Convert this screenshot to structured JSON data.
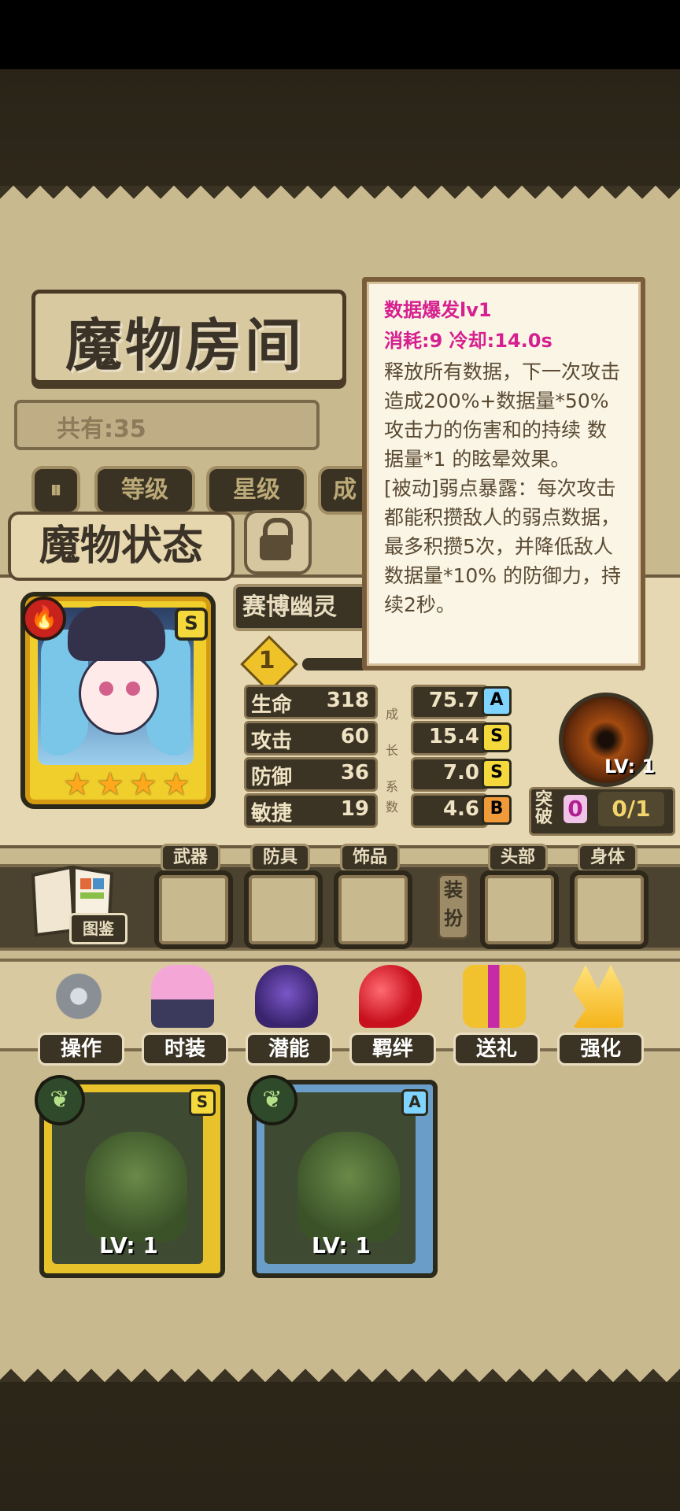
{
  "screen": {
    "title": "魔物房间",
    "count_label": "共有:35",
    "filters": [
      {
        "label": "等级"
      },
      {
        "label": "星级"
      },
      {
        "label": "成"
      }
    ]
  },
  "status": {
    "title": "魔物状态",
    "monster_name": "赛博幽灵",
    "level": "1",
    "rank": "S",
    "stars": [
      "★",
      "★",
      "★",
      "★"
    ],
    "stats": [
      {
        "label": "生命",
        "value": "318",
        "growth": "75.7",
        "grade": "A",
        "grade_color": "#7fd3ff"
      },
      {
        "label": "攻击",
        "value": "60",
        "growth": "15.4",
        "grade": "S",
        "grade_color": "#f5d83b"
      },
      {
        "label": "防御",
        "value": "36",
        "growth": "7.0",
        "grade": "S",
        "grade_color": "#f5d83b"
      },
      {
        "label": "敏捷",
        "value": "19",
        "growth": "4.6",
        "grade": "B",
        "grade_color": "#f09a3a"
      }
    ],
    "growth_label": [
      "成",
      "长",
      "系",
      "数"
    ],
    "orb_level": "LV: 1",
    "break_label": "突破",
    "break_count": "0",
    "break_progress": "0/1"
  },
  "equipment": {
    "book_label": "图鉴",
    "slots": [
      {
        "label": "武器"
      },
      {
        "label": "防具"
      },
      {
        "label": "饰品"
      },
      {
        "label": "头部"
      },
      {
        "label": "身体"
      }
    ],
    "dress_label": "装扮"
  },
  "actions": [
    {
      "label": "操作",
      "icon": "gear-icon",
      "color": "#8a8f96"
    },
    {
      "label": "时装",
      "icon": "outfit-icon",
      "color": "#f4a7d6"
    },
    {
      "label": "潜能",
      "icon": "demon-icon",
      "color": "#5b3c9c"
    },
    {
      "label": "羁绊",
      "icon": "hearts-icon",
      "color": "#e0283a"
    },
    {
      "label": "送礼",
      "icon": "gift-icon",
      "color": "#f2c12e"
    },
    {
      "label": "强化",
      "icon": "arrows-up-icon",
      "color": "#f5b41b"
    }
  ],
  "cards": [
    {
      "rank": "S",
      "level": "LV: 1",
      "frame": "#e7c22a"
    },
    {
      "rank": "A",
      "level": "LV: 1",
      "frame": "#6a9ec8"
    }
  ],
  "tooltip": {
    "title": "数据爆发lv1",
    "cost": "消耗:9   冷却:14.0s",
    "body": "释放所有数据，下一次攻击造成200%+数据量*50%攻击力的伤害和的持续 数据量*1 的眩晕效果。\n[被动]弱点暴露：每次攻击都能积攒敌人的弱点数据，最多积攒5次，并降低敌人 数据量*10% 的防御力，持续2秒。"
  }
}
